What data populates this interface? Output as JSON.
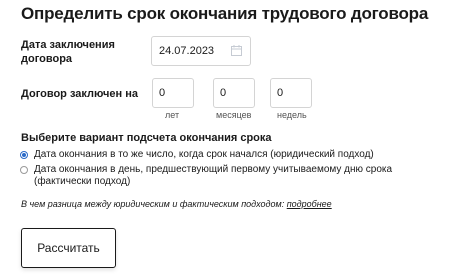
{
  "title": "Определить срок окончания трудового договора",
  "date_label": "Дата заключения договора",
  "date_value": "24.07.2023",
  "term_label": "Договор заключен на",
  "term_fields": [
    {
      "value": "0",
      "unit": "лет"
    },
    {
      "value": "0",
      "unit": "месяцев"
    },
    {
      "value": "0",
      "unit": "недель"
    }
  ],
  "calc_section_title": "Выберите вариант подсчета окончания срока",
  "options": [
    {
      "label": "Дата окончания в то же число, когда срок начался (юридический подход)",
      "selected": true
    },
    {
      "label": "Дата окончания в день, предшествующий первому учитываемому дню срока (фактически подход)",
      "selected": false
    }
  ],
  "note_text": "В чем разница между юридическим и фактическим подходом: ",
  "note_link": "подробнее",
  "submit_label": "Рассчитать",
  "colors": {
    "accent": "#2a6ac8",
    "text": "#1a1a1a",
    "border": "#d4d4d4"
  },
  "icons": {
    "date": "calendar-icon"
  }
}
